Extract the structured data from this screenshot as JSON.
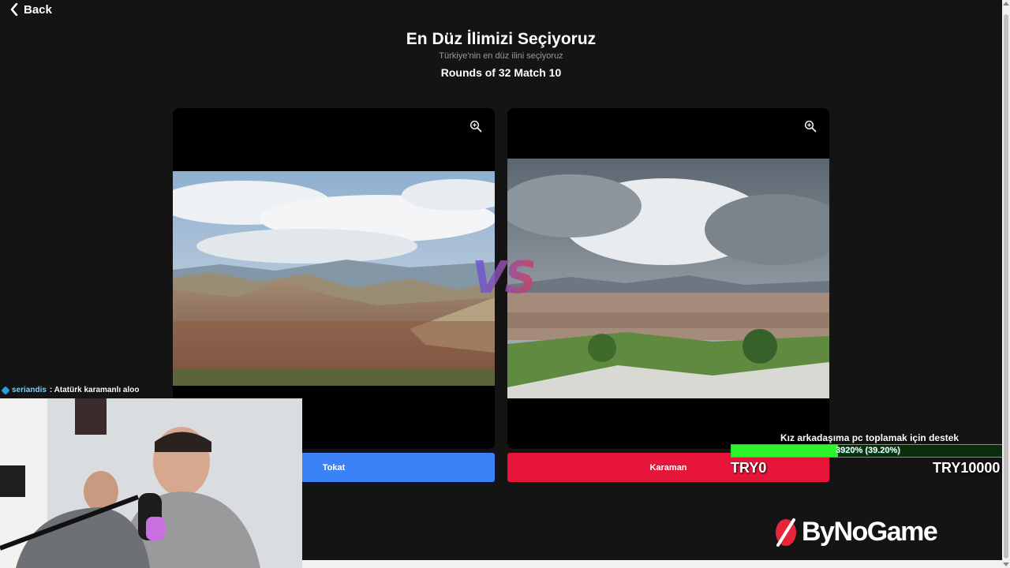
{
  "nav": {
    "back_label": "Back"
  },
  "header": {
    "title": "En Düz İlimizi Seçiyoruz",
    "subtitle": "Türkiye'nin en düz ilini seçiyoruz",
    "round": "Rounds of 32 Match 10"
  },
  "vs_label": "VS",
  "candidates": [
    {
      "name": "Tokat",
      "button_color": "#3b82f6",
      "icon": "zoom-in-icon"
    },
    {
      "name": "Karaman",
      "button_color": "#e8153a",
      "icon": "zoom-in-icon"
    }
  ],
  "chat": {
    "user": "seriandis",
    "message": ": Atatürk karamanlı aloo"
  },
  "donation": {
    "title": "Kız arkadaşıma pc toplamak için destek",
    "percent_text": "3920% (39.20%)",
    "progress": 0.392,
    "min_label": "TRY0",
    "max_label": "TRY10000",
    "color": "#2cf52c"
  },
  "brand": {
    "logo_text": "ByNoGame"
  }
}
